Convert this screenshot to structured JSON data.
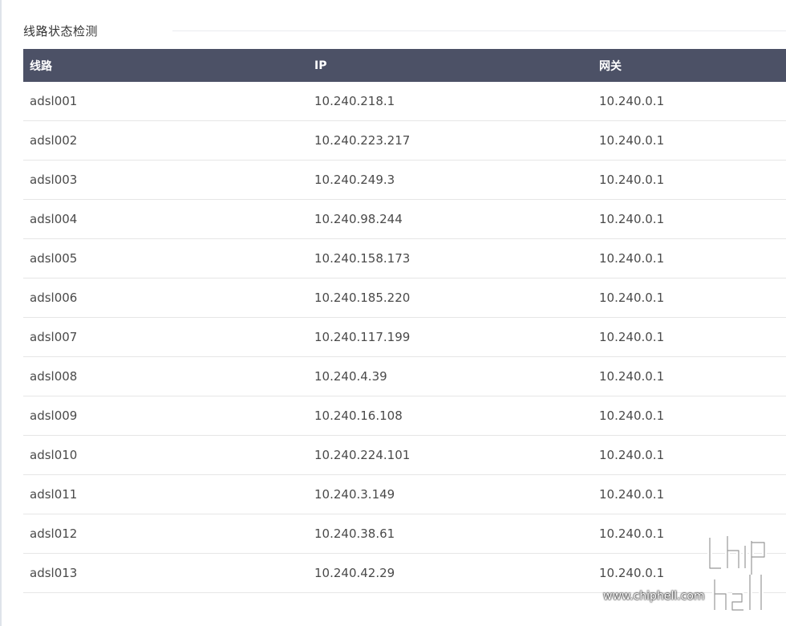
{
  "section": {
    "title": "线路状态检测"
  },
  "table": {
    "headers": {
      "line": "线路",
      "ip": "IP",
      "gateway": "网关"
    },
    "rows": [
      {
        "line": "adsl001",
        "ip": "10.240.218.1",
        "gateway": "10.240.0.1"
      },
      {
        "line": "adsl002",
        "ip": "10.240.223.217",
        "gateway": "10.240.0.1"
      },
      {
        "line": "adsl003",
        "ip": "10.240.249.3",
        "gateway": "10.240.0.1"
      },
      {
        "line": "adsl004",
        "ip": "10.240.98.244",
        "gateway": "10.240.0.1"
      },
      {
        "line": "adsl005",
        "ip": "10.240.158.173",
        "gateway": "10.240.0.1"
      },
      {
        "line": "adsl006",
        "ip": "10.240.185.220",
        "gateway": "10.240.0.1"
      },
      {
        "line": "adsl007",
        "ip": "10.240.117.199",
        "gateway": "10.240.0.1"
      },
      {
        "line": "adsl008",
        "ip": "10.240.4.39",
        "gateway": "10.240.0.1"
      },
      {
        "line": "adsl009",
        "ip": "10.240.16.108",
        "gateway": "10.240.0.1"
      },
      {
        "line": "adsl010",
        "ip": "10.240.224.101",
        "gateway": "10.240.0.1"
      },
      {
        "line": "adsl011",
        "ip": "10.240.3.149",
        "gateway": "10.240.0.1"
      },
      {
        "line": "adsl012",
        "ip": "10.240.38.61",
        "gateway": "10.240.0.1"
      },
      {
        "line": "adsl013",
        "ip": "10.240.42.29",
        "gateway": "10.240.0.1"
      }
    ]
  },
  "watermark": {
    "url": "www.chiphell.com",
    "logo_icon": "chiphell-logo-icon"
  },
  "colors": {
    "header_bg": "#4c5166",
    "header_text": "#ffffff",
    "row_divider": "#e6e6e6"
  }
}
